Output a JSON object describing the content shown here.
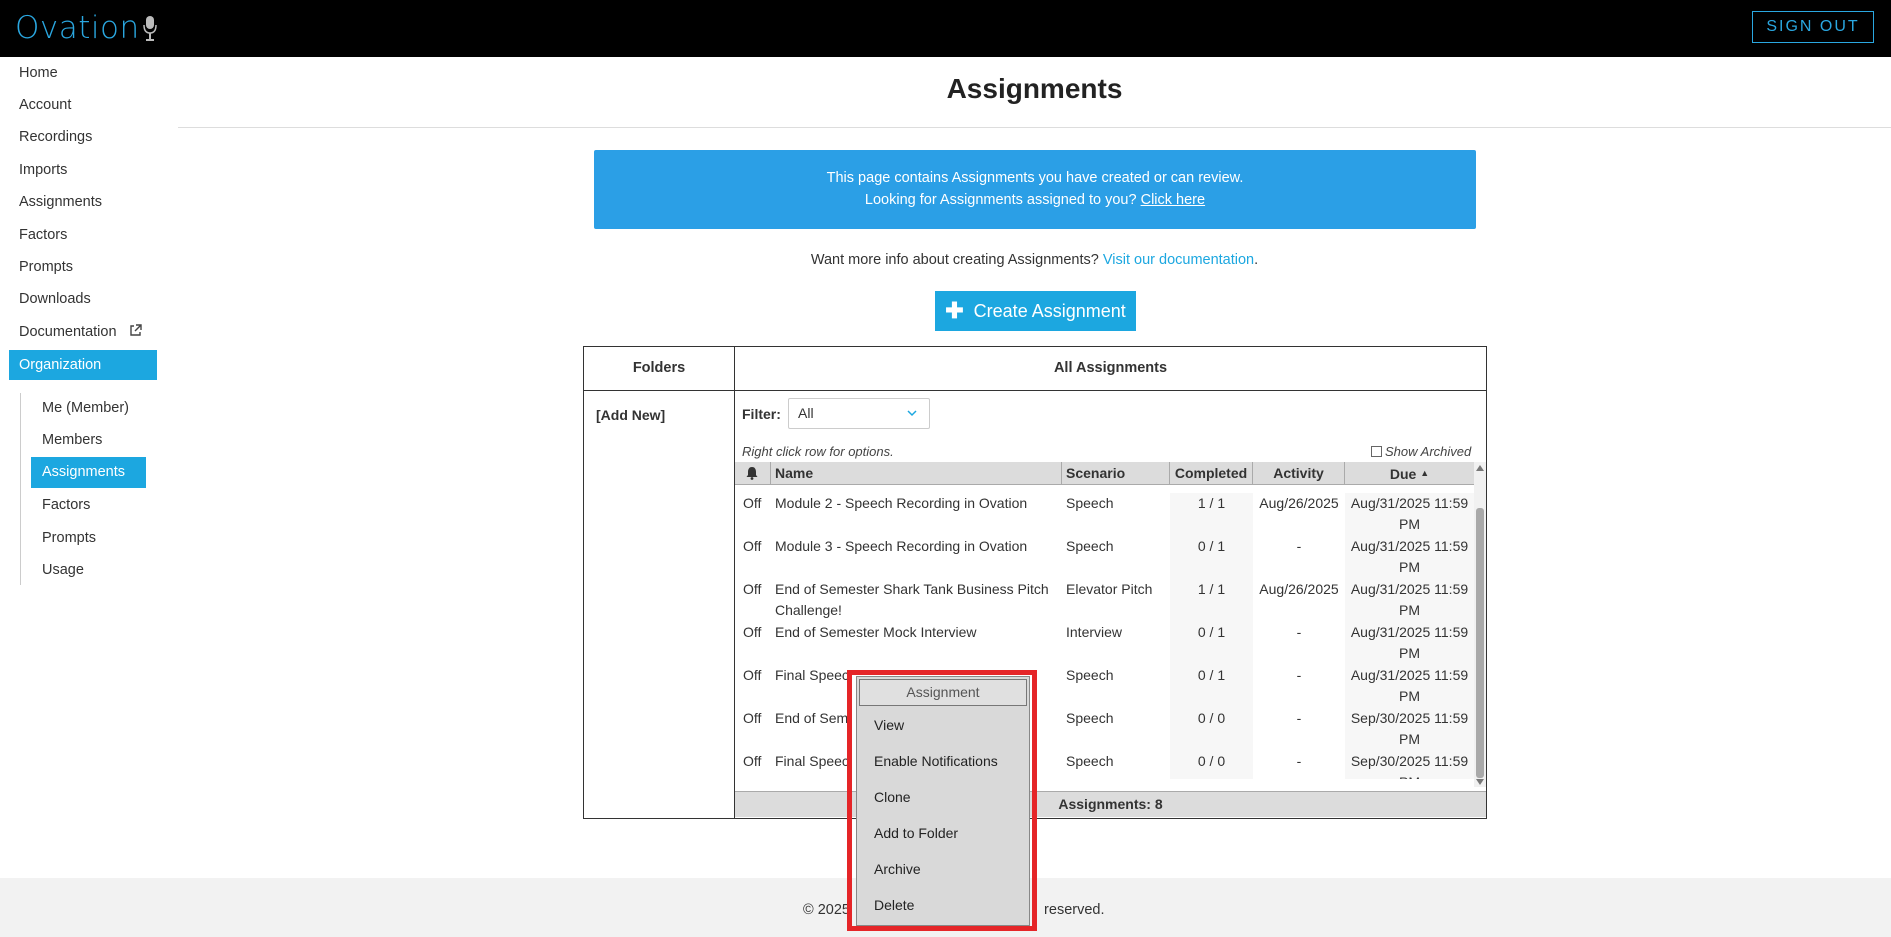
{
  "app": {
    "logo": "Ovation",
    "signout": "SIGN OUT"
  },
  "sidebar": {
    "items": [
      {
        "label": "Home"
      },
      {
        "label": "Account"
      },
      {
        "label": "Recordings"
      },
      {
        "label": "Imports"
      },
      {
        "label": "Assignments"
      },
      {
        "label": "Factors"
      },
      {
        "label": "Prompts"
      },
      {
        "label": "Downloads"
      },
      {
        "label": "Documentation"
      },
      {
        "label": "Organization"
      }
    ],
    "subitems": [
      {
        "label": "Me (Member)"
      },
      {
        "label": "Members"
      },
      {
        "label": "Assignments"
      },
      {
        "label": "Factors"
      },
      {
        "label": "Prompts"
      },
      {
        "label": "Usage"
      }
    ]
  },
  "page": {
    "title": "Assignments",
    "info_line1": "This page contains Assignments you have created or can review.",
    "info_line2": "Looking for Assignments assigned to you?",
    "info_link": "Click here",
    "more_info": "Want more info about creating Assignments?",
    "more_info_link": "Visit our documentation",
    "more_info_end": ".",
    "create_button": "Create Assignment"
  },
  "panel": {
    "folders_header": "Folders",
    "all_header": "All Assignments",
    "add_new": "[Add New]",
    "filter_label": "Filter:",
    "filter_value": "All",
    "hint": "Right click row for options.",
    "show_archived": "Show Archived",
    "columns": {
      "name": "Name",
      "scenario": "Scenario",
      "completed": "Completed",
      "activity": "Activity",
      "due": "Due"
    },
    "rows": [
      {
        "notif": "Off",
        "name1": "Module 2 - Speech Recording in Ovation",
        "name2": "",
        "scenario": "Speech",
        "completed": "1 / 1",
        "activity": "Aug/26/2025",
        "due1": "Aug/31/2025 11:59",
        "due2": "PM"
      },
      {
        "notif": "Off",
        "name1": "Module 3 - Speech Recording in Ovation",
        "name2": "",
        "scenario": "Speech",
        "completed": "0 / 1",
        "activity": "-",
        "due1": "Aug/31/2025 11:59",
        "due2": "PM"
      },
      {
        "notif": "Off",
        "name1": "End of Semester Shark Tank Business Pitch",
        "name2": "Challenge!",
        "scenario": "Elevator Pitch",
        "completed": "1 / 1",
        "activity": "Aug/26/2025",
        "due1": "Aug/31/2025 11:59",
        "due2": "PM"
      },
      {
        "notif": "Off",
        "name1": "End of Semester Mock Interview",
        "name2": "",
        "scenario": "Interview",
        "completed": "0 / 1",
        "activity": "-",
        "due1": "Aug/31/2025 11:59",
        "due2": "PM"
      },
      {
        "notif": "Off",
        "name1": "Final Speec",
        "name2": "",
        "scenario": "Speech",
        "completed": "0 / 1",
        "activity": "-",
        "due1": "Aug/31/2025 11:59",
        "due2": "PM"
      },
      {
        "notif": "Off",
        "name1": "End of Sem",
        "name2": "",
        "scenario": "Speech",
        "completed": "0 / 0",
        "activity": "-",
        "due1": "Sep/30/2025 11:59",
        "due2": "PM"
      },
      {
        "notif": "Off",
        "name1": "Final Speec",
        "name2": "",
        "scenario": "Speech",
        "completed": "0 / 0",
        "activity": "-",
        "due1": "Sep/30/2025 11:59",
        "due2": "PM"
      }
    ],
    "footer": "Assignments: 8"
  },
  "footer": {
    "left": "© 2025",
    "right": "reserved."
  },
  "context_menu": {
    "title": "Assignment",
    "items": [
      "View",
      "Enable Notifications",
      "Clone",
      "Add to Folder",
      "Archive",
      "Delete"
    ]
  },
  "colors": {
    "accent": "#1ca7e0",
    "info_bg": "#2b9fe6",
    "highlight": "#e52528"
  }
}
